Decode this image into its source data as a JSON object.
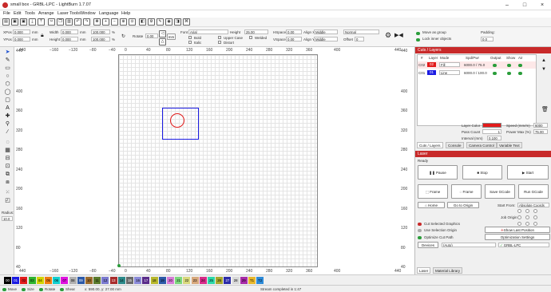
{
  "window": {
    "title": "small box - GRBL-LPC - LightBurn 1.7.07"
  },
  "menu": [
    "File",
    "Edit",
    "Tools",
    "Arrange",
    "Laser Tools",
    "Window",
    "Language",
    "Help"
  ],
  "toolbar2": {
    "xpos_label": "XPos",
    "xpos": "0.000",
    "ypos_label": "YPos",
    "ypos": "0.000",
    "unit": "mm",
    "width_label": "Width",
    "width": "0.000",
    "height_label": "Height",
    "height": "0.000",
    "pct": "100.000",
    "pct_sign": "%",
    "rotate_label": "Rotate",
    "rotate": "0.00",
    "mm_btn": "mm",
    "font_label": "Font",
    "font": "Arial",
    "fheight_label": "Height",
    "fheight": "25.00",
    "hspace_label": "HSpace",
    "hspace": "0.00",
    "vspace_label": "VSpace",
    "vspace": "0.00",
    "alignx_label": "Align X",
    "alignx": "Middle",
    "aligny_label": "Align Y",
    "aligny": "Middle",
    "normal": "Normal",
    "offset_label": "Offset",
    "offset": "0",
    "bold": "Bold",
    "italic": "Italic",
    "upper": "Upper Case",
    "welded": "Welded",
    "distort": "Distort",
    "move_group": "Move as group",
    "lock_inner": "Lock inner objects",
    "padding_label": "Padding:",
    "padding": "0.0"
  },
  "ruler": {
    "top": [
      "440",
      "−160",
      "−120",
      "−80",
      "−40",
      "0",
      "40",
      "80",
      "120",
      "160",
      "200",
      "240",
      "280",
      "320",
      "360",
      "400",
      "440"
    ],
    "bottom": [
      "440",
      "−160",
      "−120",
      "−80",
      "−40",
      "0",
      "40",
      "80",
      "120",
      "160",
      "200",
      "240",
      "280",
      "320",
      "360",
      "400",
      "440"
    ],
    "left": [
      "440",
      "400",
      "360",
      "320",
      "280",
      "240",
      "200",
      "160",
      "120",
      "80",
      "40",
      "0"
    ],
    "right": [
      "440",
      "400",
      "360",
      "320",
      "280",
      "240",
      "200",
      "160",
      "120",
      "80",
      "40",
      "0"
    ]
  },
  "radius": {
    "label": "Radius:",
    "value": "10.0"
  },
  "cuts": {
    "title": "Cuts / Layers",
    "headers": [
      "#",
      "Layer",
      "Mode",
      "Spd/Pwr",
      "Output",
      "Show",
      "Air"
    ],
    "rows": [
      {
        "id": "C02",
        "layer": "02",
        "mode": "Fill",
        "spdpwr": "6000.0 / 75.0",
        "color": "#e21b1b"
      },
      {
        "id": "C01",
        "layer": "01",
        "mode": "Line",
        "spdpwr": "6000.0 / 100.0",
        "color": "#1b1be2"
      }
    ],
    "layer_color_label": "Layer Color",
    "speed_label": "Speed (mm/m)",
    "speed": "6000",
    "pass_label": "Pass Count",
    "pass": "1",
    "power_label": "Power Max (%)",
    "power": "75.00",
    "interval_label": "Interval (mm)",
    "interval": "0.100"
  },
  "tabs1": [
    "Cuts / Layers",
    "Console",
    "Camera Control",
    "Variable Text"
  ],
  "laser": {
    "title": "Laser",
    "status": "Ready",
    "pause": "Pause",
    "stop": "Stop",
    "start": "Start",
    "frame1": "Frame",
    "frame2": "Frame",
    "save_gcode": "Save GCode",
    "run_gcode": "Run GCode",
    "home": "Home",
    "goto_origin": "Go to Origin",
    "start_from_label": "Start From:",
    "start_from": "Absolute Coords",
    "job_origin": "Job Origin",
    "cut_selected": "Cut Selected Graphics",
    "use_sel_origin": "Use Selection Origin",
    "show_last": "Show Last Position",
    "optimize_cut": "Optimize Cut Path",
    "opt_settings": "Optimization Settings",
    "devices": "Devices",
    "auto": "(Auto)",
    "device_name": "GRBL-LPC"
  },
  "tabs2": [
    "Laser",
    "Material Library"
  ],
  "palette": [
    {
      "l": "00",
      "c": "#000000"
    },
    {
      "l": "01",
      "c": "#1b1be2"
    },
    {
      "l": "02",
      "c": "#e21b1b"
    },
    {
      "l": "03",
      "c": "#2fb52f"
    },
    {
      "l": "04",
      "c": "#d4d400"
    },
    {
      "l": "05",
      "c": "#f07c12"
    },
    {
      "l": "06",
      "c": "#12d0d0"
    },
    {
      "l": "07",
      "c": "#e012e0"
    },
    {
      "l": "08",
      "c": "#b0b0b0"
    },
    {
      "l": "09",
      "c": "#2c59a8"
    },
    {
      "l": "10",
      "c": "#9c6b2c"
    },
    {
      "l": "11",
      "c": "#5a7a2c"
    },
    {
      "l": "12",
      "c": "#7a7ad0"
    },
    {
      "l": "13",
      "c": "#a82c2c"
    },
    {
      "l": "14",
      "c": "#2c8a8a"
    },
    {
      "l": "15",
      "c": "#6a6a6a"
    },
    {
      "l": "16",
      "c": "#8a8ad8"
    },
    {
      "l": "17",
      "c": "#5a2c8a"
    },
    {
      "l": "18",
      "c": "#b8b82c"
    },
    {
      "l": "19",
      "c": "#2c5aa8"
    },
    {
      "l": "20",
      "c": "#d87cd8"
    },
    {
      "l": "21",
      "c": "#7cd87c"
    },
    {
      "l": "22",
      "c": "#d8d87c"
    },
    {
      "l": "23",
      "c": "#d8a87c"
    },
    {
      "l": "24",
      "c": "#d82c8a"
    },
    {
      "l": "25",
      "c": "#2cd8a8"
    },
    {
      "l": "26",
      "c": "#a8a82c"
    },
    {
      "l": "27",
      "c": "#2c2ca8"
    },
    {
      "l": "28",
      "c": "#d8d8d8"
    },
    {
      "l": "29",
      "c": "#a82ca8"
    },
    {
      "l": "T1",
      "c": "#e8b82c"
    },
    {
      "l": "T2",
      "c": "#2c8ad8"
    }
  ],
  "status": {
    "move": "Move",
    "size": "Size",
    "rotate": "Rotate",
    "shear": "Shear",
    "coords": "x: 590.00, y: 27.00 mm",
    "message": "Stream completed in 1:47"
  }
}
